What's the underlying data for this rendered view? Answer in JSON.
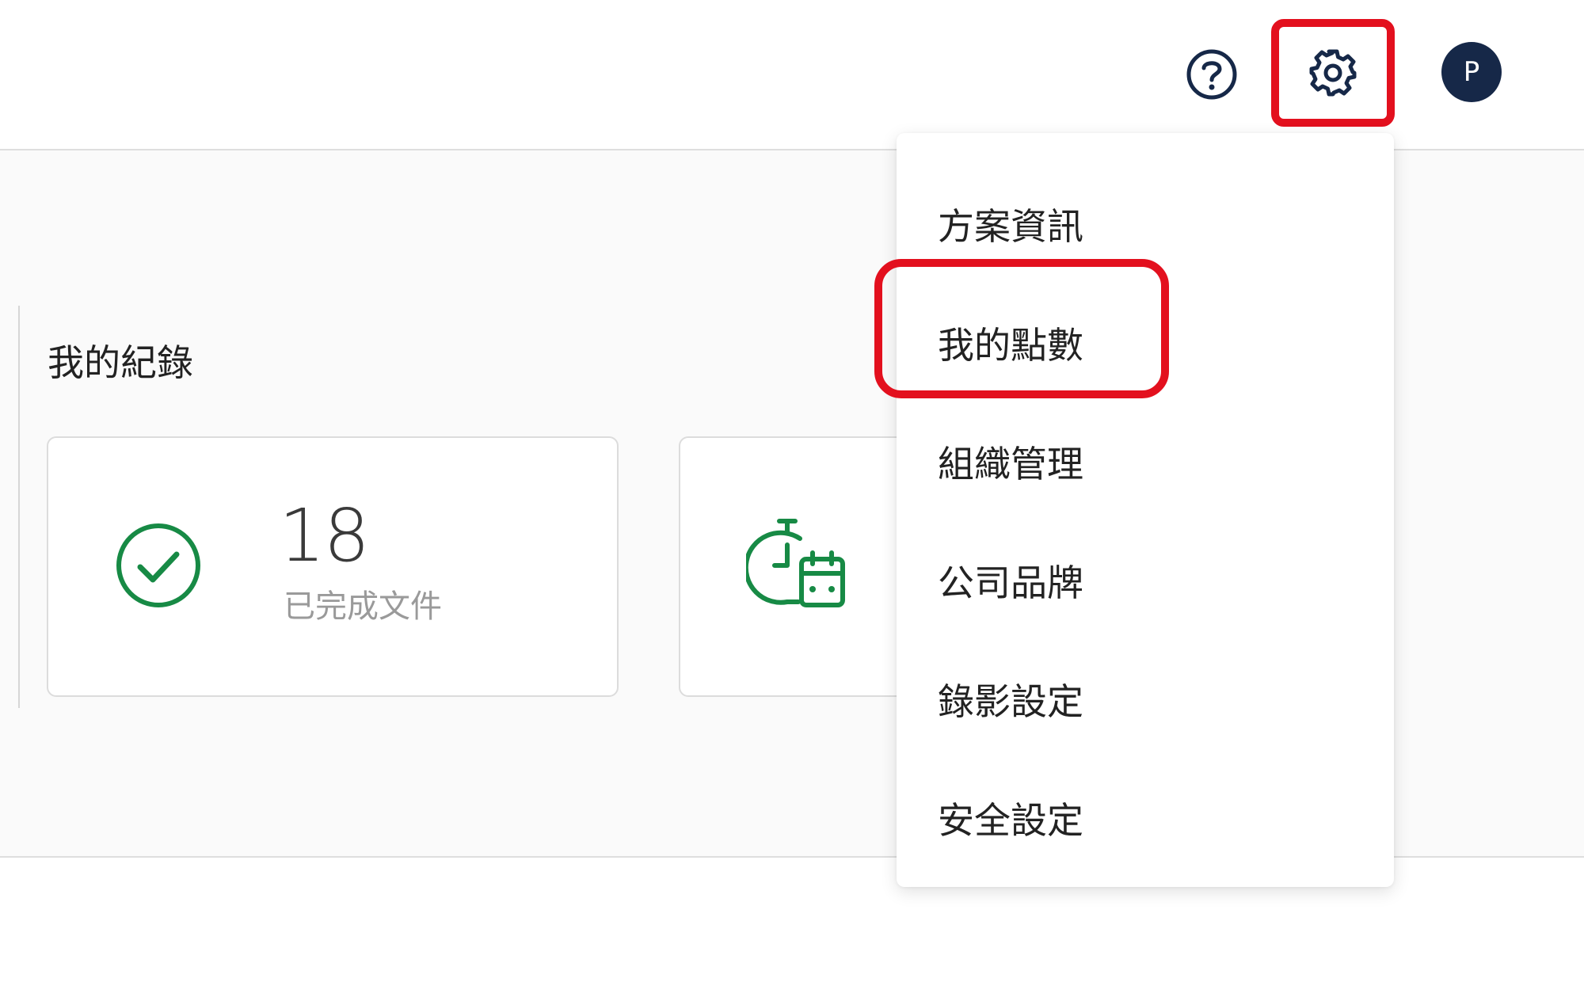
{
  "header": {
    "help_icon": "question-circle-icon",
    "settings_icon": "gear-icon",
    "avatar_initial": "P"
  },
  "records": {
    "title": "我的紀錄",
    "cards": [
      {
        "icon": "check-circle-icon",
        "value": "18",
        "label": "已完成文件"
      },
      {
        "icon": "stopwatch-calendar-icon"
      }
    ]
  },
  "settings_menu": {
    "items": [
      {
        "label": "方案資訊"
      },
      {
        "label": "我的點數"
      },
      {
        "label": "組織管理"
      },
      {
        "label": "公司品牌"
      },
      {
        "label": "錄影設定"
      },
      {
        "label": "安全設定"
      }
    ]
  },
  "colors": {
    "accent_green": "#178a45",
    "avatar_bg": "#162848",
    "highlight_red": "#e3101e"
  }
}
